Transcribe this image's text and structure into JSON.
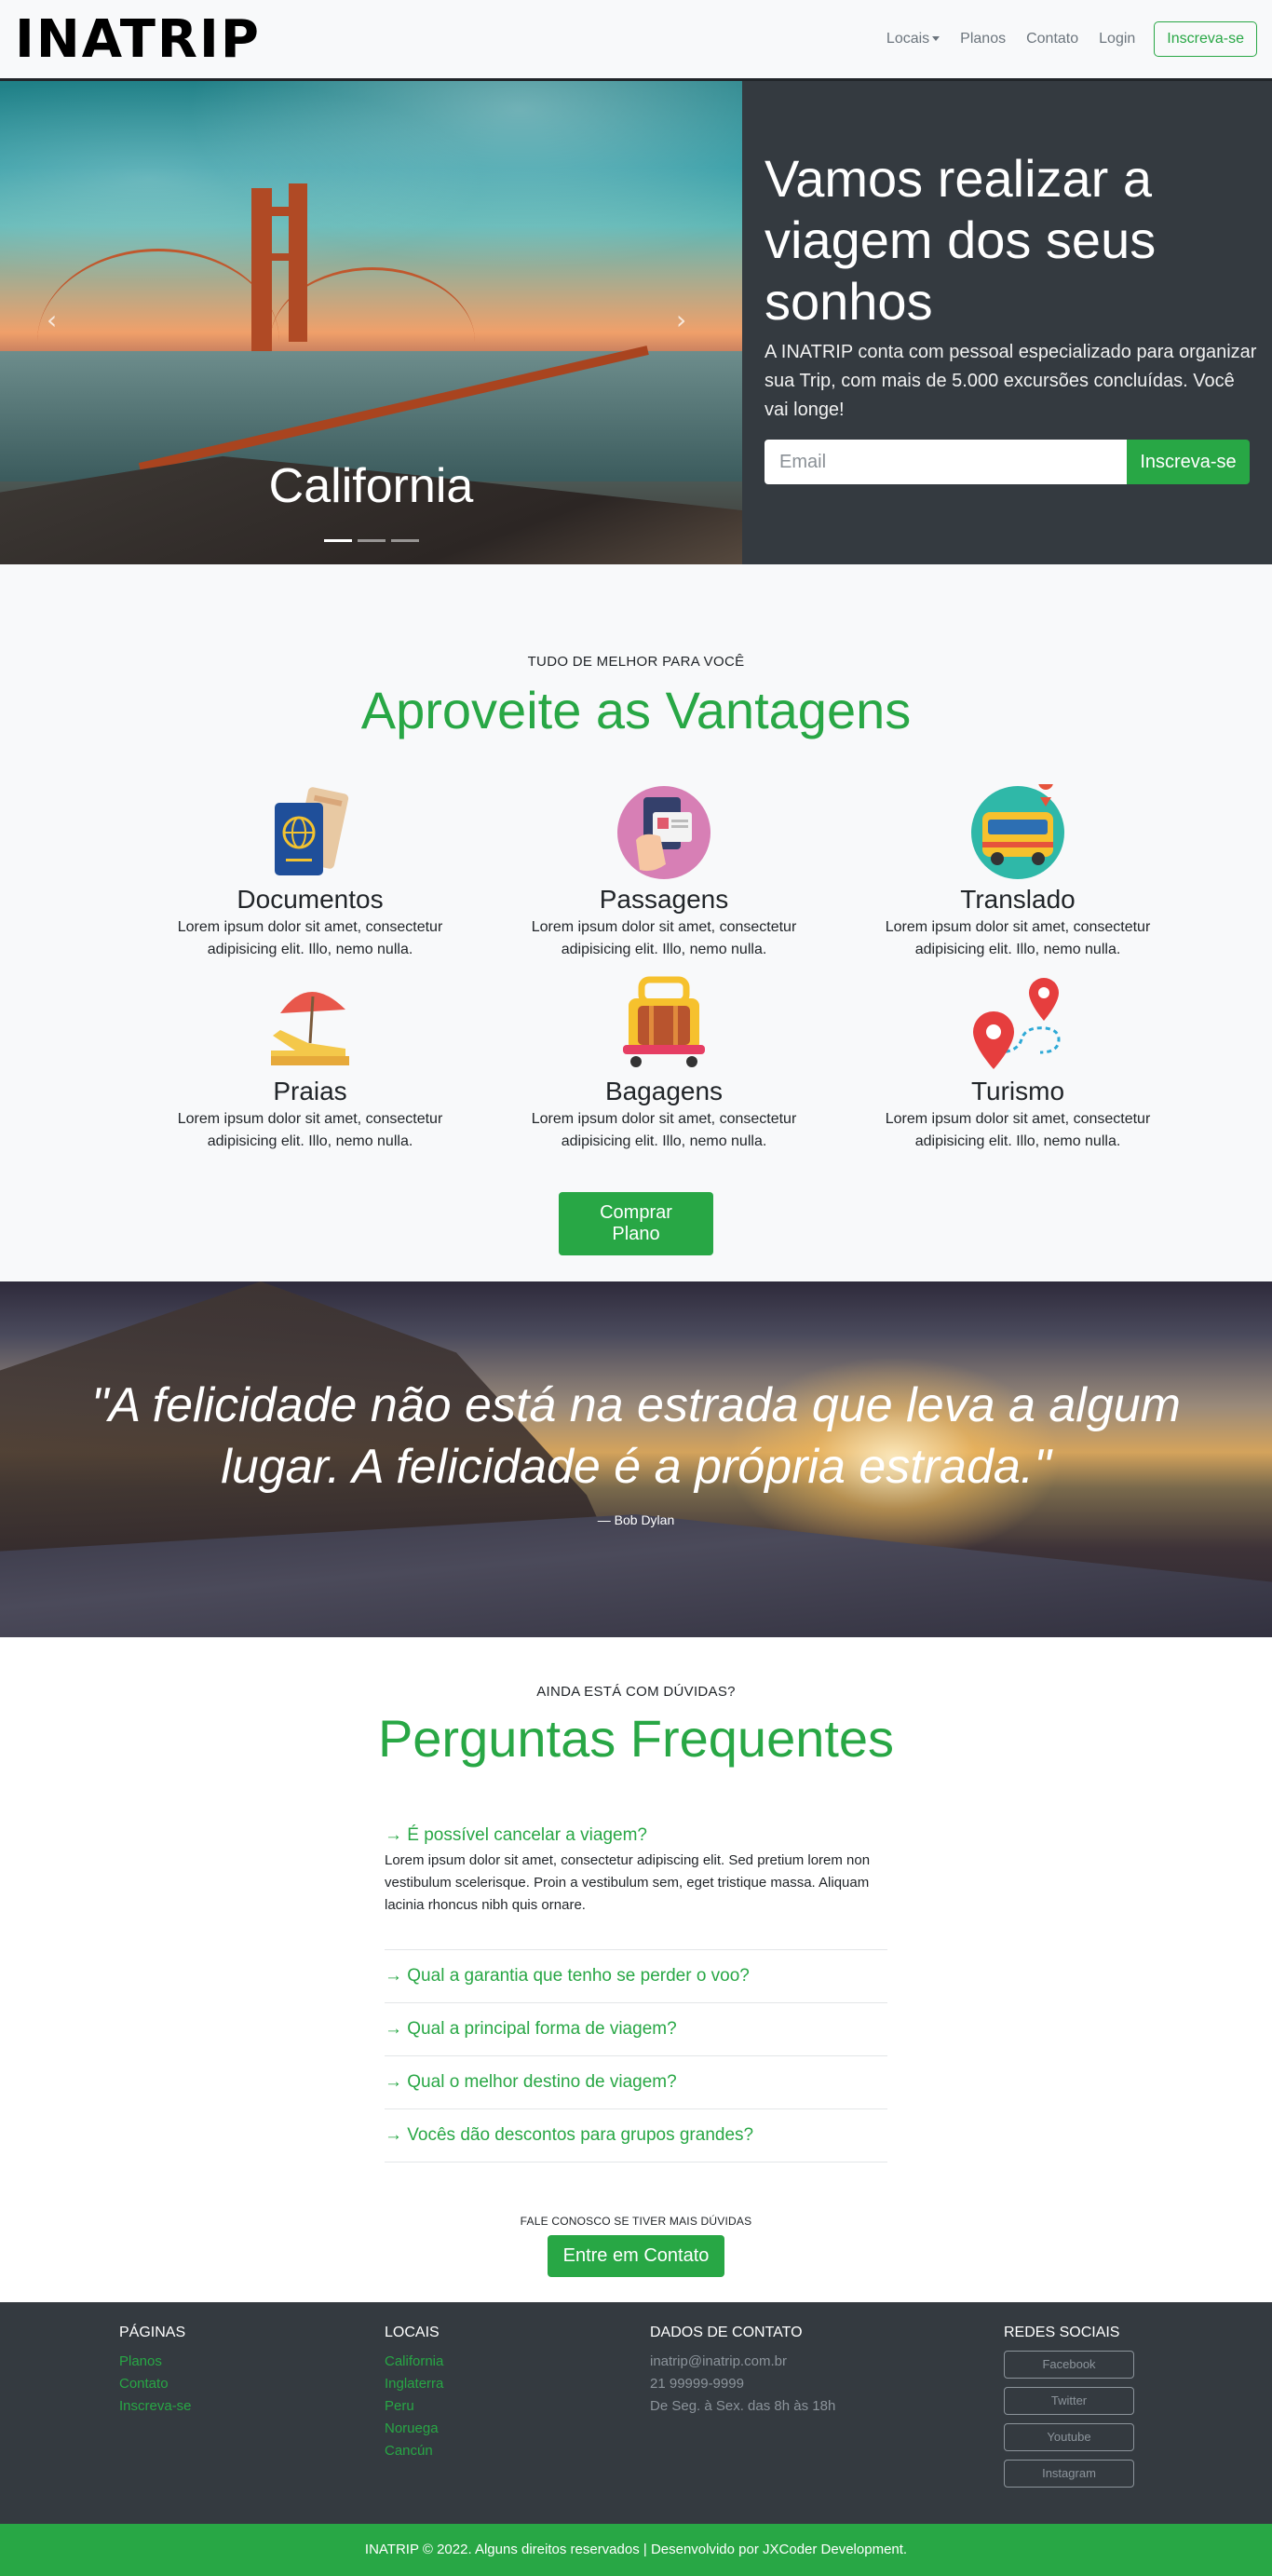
{
  "navbar": {
    "brand": "INATRIP",
    "links": [
      "Locais",
      "Planos",
      "Contato",
      "Login"
    ],
    "signup_label": "Inscreva-se"
  },
  "hero": {
    "carousel_caption": "California",
    "carousel_slides": 3,
    "carousel_active_index": 0,
    "title": "Vamos realizar a viagem dos seus sonhos",
    "text": "A INATRIP conta com pessoal especializado para organizar sua Trip, com mais de 5.000 excursões concluídas. Você vai longe!",
    "email_placeholder": "Email",
    "signup_button": "Inscreva-se"
  },
  "vantagens": {
    "kicker": "TUDO DE MELHOR PARA VOCÊ",
    "title": "Aproveite as Vantagens",
    "items": [
      {
        "icon": "passport-icon",
        "title": "Documentos",
        "text": "Lorem ipsum dolor sit amet, consectetur adipisicing elit. Illo, nemo nulla."
      },
      {
        "icon": "ticket-icon",
        "title": "Passagens",
        "text": "Lorem ipsum dolor sit amet, consectetur adipisicing elit. Illo, nemo nulla."
      },
      {
        "icon": "bus-icon",
        "title": "Translado",
        "text": "Lorem ipsum dolor sit amet, consectetur adipisicing elit. Illo, nemo nulla."
      },
      {
        "icon": "beach-icon",
        "title": "Praias",
        "text": "Lorem ipsum dolor sit amet, consectetur adipisicing elit. Illo, nemo nulla."
      },
      {
        "icon": "luggage-icon",
        "title": "Bagagens",
        "text": "Lorem ipsum dolor sit amet, consectetur adipisicing elit. Illo, nemo nulla."
      },
      {
        "icon": "map-pin-icon",
        "title": "Turismo",
        "text": "Lorem ipsum dolor sit amet, consectetur adipisicing elit. Illo, nemo nulla."
      }
    ],
    "button": "Comprar Plano"
  },
  "quote": {
    "text": "\"A felicidade não está na estrada que leva a algum lugar. A felicidade é a própria estrada.\"",
    "author": "— Bob Dylan"
  },
  "faq": {
    "kicker": "AINDA ESTÁ COM DÚVIDAS?",
    "title": "Perguntas Frequentes",
    "items": [
      {
        "question": "→ É possível cancelar a viagem?",
        "answer": "Lorem ipsum dolor sit amet, consectetur adipiscing elit. Sed pretium lorem non vestibulum scelerisque. Proin a vestibulum sem, eget tristique massa. Aliquam lacinia rhoncus nibh quis ornare."
      },
      {
        "question": "→ Qual a garantia que tenho se perder o voo?"
      },
      {
        "question": "→ Qual a principal forma de viagem?"
      },
      {
        "question": "→ Qual o melhor destino de viagem?"
      },
      {
        "question": "→ Vocês dão descontos para grupos grandes?"
      }
    ],
    "cta_text": "FALE CONOSCO SE TIVER MAIS DÚVIDAS",
    "cta_button": "Entre em Contato"
  },
  "footer": {
    "paginas": {
      "title": "PÁGINAS",
      "links": [
        "Planos",
        "Contato",
        "Inscreva-se"
      ]
    },
    "locais": {
      "title": "LOCAIS",
      "links": [
        "California",
        "Inglaterra",
        "Peru",
        "Noruega",
        "Cancún"
      ]
    },
    "contato": {
      "title": "DADOS DE CONTATO",
      "lines": [
        "inatrip@inatrip.com.br",
        "21 99999-9999",
        "De Seg. à Sex. das 8h às 18h"
      ]
    },
    "redes": {
      "title": "REDES SOCIAIS",
      "buttons": [
        "Facebook",
        "Twitter",
        "Youtube",
        "Instagram"
      ]
    },
    "copyright": "INATRIP © 2022. Alguns direitos reservados | Desenvolvido por JXCoder Development."
  },
  "colors": {
    "accent": "#28a745",
    "dark": "#343a40",
    "light": "#f8f9fa"
  }
}
